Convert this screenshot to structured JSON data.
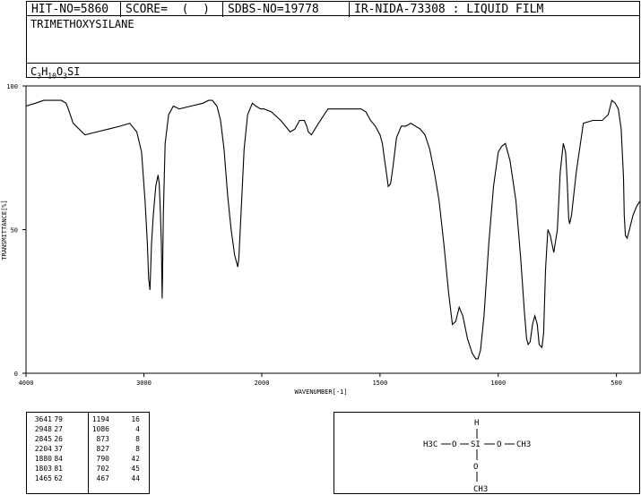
{
  "header": {
    "hit_no": "HIT-NO=5860",
    "score": "SCORE=  (  )",
    "sdbs_no": "SDBS-NO=19778",
    "ir_nida": "IR-NIDA-73308 : LIQUID FILM"
  },
  "compound": {
    "name": "TRIMETHOXYSILANE",
    "formula_parts": [
      "C",
      "3",
      "H",
      "10",
      "O",
      "3",
      "SI"
    ]
  },
  "chart_data": {
    "type": "line",
    "xlabel": "WAVENUMBER[-1]",
    "ylabel": "TRANSMITTANCE[%]",
    "xlim": [
      4000,
      400
    ],
    "ylim": [
      0,
      100
    ],
    "x_ticks": [
      "4000",
      "3000",
      "2000",
      "1500",
      "1000",
      "500"
    ],
    "y_ticks": [
      "100",
      "50",
      "0"
    ],
    "series": [
      {
        "x": [
          4000,
          3920,
          3850,
          3760,
          3700,
          3660,
          3641,
          3600,
          3500,
          3400,
          3300,
          3200,
          3120,
          3060,
          3020,
          2990,
          2970,
          2960,
          2948,
          2935,
          2920,
          2900,
          2880,
          2870,
          2860,
          2852,
          2848,
          2845,
          2842,
          2835,
          2820,
          2790,
          2750,
          2700,
          2600,
          2500,
          2450,
          2420,
          2380,
          2350,
          2320,
          2290,
          2260,
          2230,
          2210,
          2204,
          2195,
          2180,
          2150,
          2120,
          2080,
          2050,
          2010,
          1990,
          1960,
          1920,
          1900,
          1880,
          1860,
          1840,
          1820,
          1810,
          1803,
          1790,
          1760,
          1720,
          1680,
          1650,
          1620,
          1580,
          1560,
          1540,
          1520,
          1500,
          1490,
          1480,
          1470,
          1465,
          1455,
          1445,
          1430,
          1410,
          1390,
          1370,
          1350,
          1330,
          1310,
          1290,
          1270,
          1250,
          1230,
          1210,
          1194,
          1180,
          1165,
          1150,
          1130,
          1110,
          1095,
          1086,
          1075,
          1060,
          1040,
          1020,
          1000,
          985,
          970,
          950,
          925,
          905,
          890,
          880,
          873,
          865,
          855,
          845,
          835,
          827,
          815,
          808,
          800,
          790,
          780,
          765,
          750,
          738,
          725,
          715,
          708,
          702,
          698,
          690,
          670,
          640,
          600,
          560,
          535,
          520,
          505,
          492,
          480,
          470,
          467,
          462,
          455,
          445,
          430,
          415,
          400
        ],
        "y": [
          93,
          94,
          95,
          95,
          95,
          94,
          92,
          87,
          83,
          84,
          85,
          86,
          87,
          84,
          77,
          60,
          45,
          33,
          29,
          45,
          55,
          65,
          69,
          66,
          56,
          45,
          34,
          26,
          34,
          55,
          80,
          90,
          93,
          92,
          93,
          94,
          95,
          95,
          93,
          88,
          78,
          62,
          50,
          41,
          38,
          37,
          40,
          52,
          78,
          90,
          94,
          93,
          92,
          92,
          91,
          88,
          86,
          84,
          85,
          88,
          88,
          86,
          84,
          83,
          87,
          92,
          92,
          92,
          92,
          92,
          91,
          88,
          86,
          83,
          80,
          74,
          68,
          65,
          66,
          72,
          82,
          86,
          86,
          87,
          86,
          85,
          83,
          78,
          70,
          60,
          45,
          28,
          17,
          18,
          23,
          20,
          12,
          7,
          5,
          5,
          8,
          20,
          45,
          65,
          77,
          79,
          80,
          74,
          60,
          40,
          22,
          12,
          10,
          11,
          17,
          20,
          17,
          10,
          9,
          14,
          36,
          50,
          48,
          42,
          50,
          70,
          80,
          77,
          66,
          54,
          52,
          55,
          70,
          87,
          88,
          88,
          90,
          95,
          94,
          92,
          85,
          68,
          55,
          48,
          47,
          50,
          55,
          58,
          60
        ]
      }
    ],
    "peak_table": [
      [
        "3641",
        "79",
        "1194",
        "16"
      ],
      [
        "2948",
        "27",
        "1086",
        "4"
      ],
      [
        "2845",
        "26",
        "873",
        "8"
      ],
      [
        "2204",
        "37",
        "827",
        "8"
      ],
      [
        "1880",
        "84",
        "790",
        "42"
      ],
      [
        "1803",
        "81",
        "702",
        "45"
      ],
      [
        "1465",
        "62",
        "467",
        "44"
      ]
    ]
  },
  "structure": {
    "top_h": "H",
    "si": "SI",
    "left_group": "H3C",
    "left_o": "O",
    "right_o": "O",
    "right_group": "CH3",
    "bottom_o": "O",
    "bottom_group": "CH3"
  }
}
